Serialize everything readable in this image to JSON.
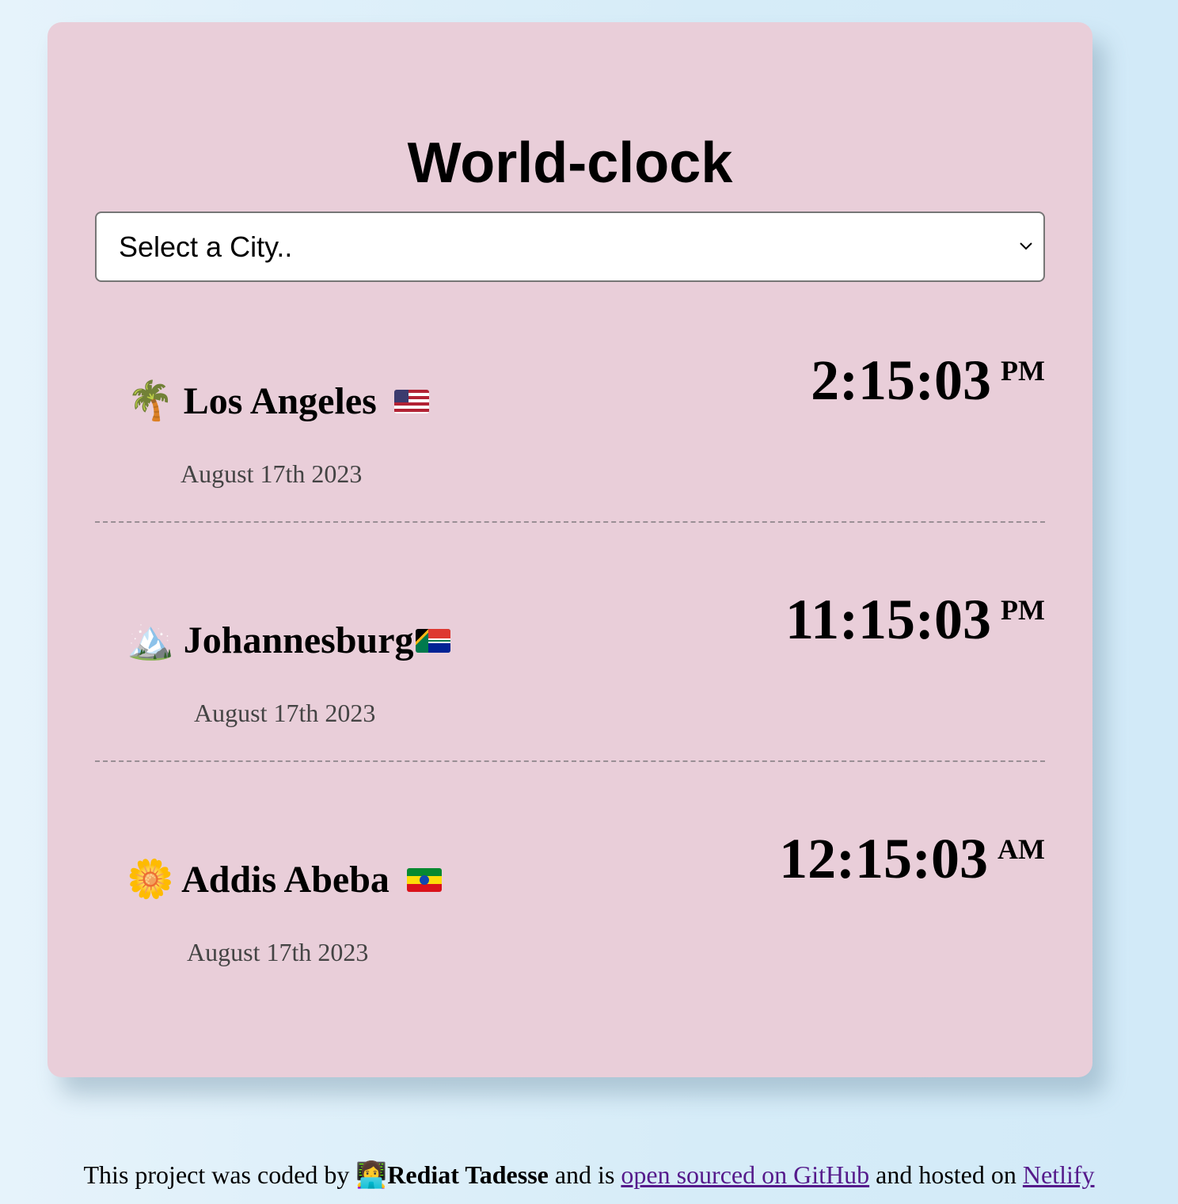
{
  "app": {
    "title": "World-clock"
  },
  "city_select": {
    "selected_label": "Select a City.."
  },
  "cities": [
    {
      "icon": "🌴",
      "icon_name": "palm-tree-icon",
      "name": "Los Angeles",
      "flag_name": "us-flag-icon",
      "date": "August 17th 2023",
      "time": "2:15:03",
      "ampm": "PM"
    },
    {
      "icon": "🏔️",
      "icon_name": "mountain-icon",
      "name": "Johannesburg",
      "flag_name": "south-africa-flag-icon",
      "date": "August 17th 2023",
      "time": "11:15:03",
      "ampm": "PM"
    },
    {
      "icon": "🌼",
      "icon_name": "blossom-icon",
      "name": "Addis Abeba",
      "flag_name": "ethiopia-flag-icon",
      "date": "August 17th 2023",
      "time": "12:15:03",
      "ampm": "AM"
    }
  ],
  "footer": {
    "text_before": "This project was coded by ",
    "author_icon": "👩‍💻",
    "author": "Rediat Tadesse",
    "text_middle": " and is ",
    "github_link": "open sourced on GitHub",
    "text_after": " and hosted on ",
    "netlify_link": "Netlify"
  },
  "colors": {
    "card_background": "#e9ced9",
    "page_background": "#d6ecf8",
    "link": "#551a8b"
  }
}
